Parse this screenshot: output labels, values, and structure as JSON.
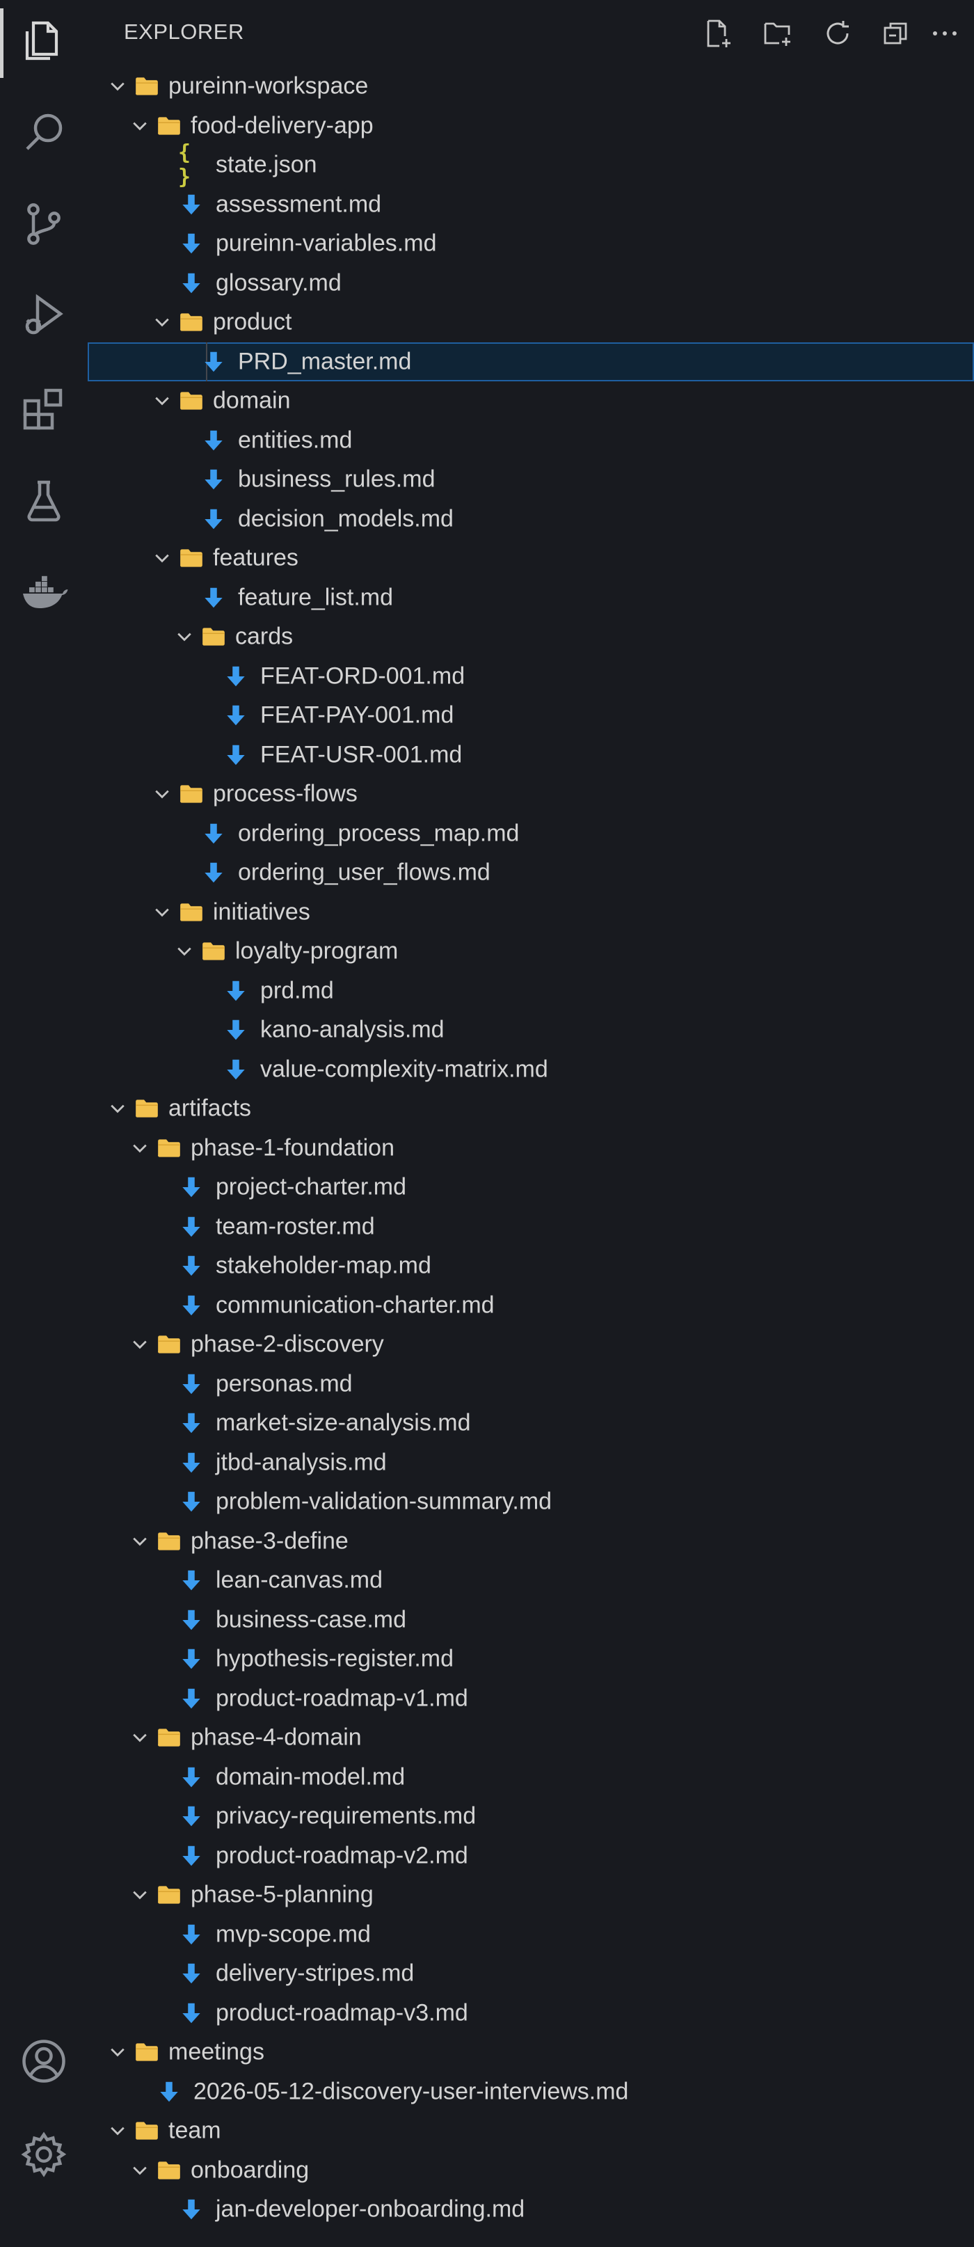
{
  "activity_bar": {
    "items": [
      {
        "name": "explorer-icon",
        "active": true
      },
      {
        "name": "search-icon"
      },
      {
        "name": "source-control-icon"
      },
      {
        "name": "run-debug-icon"
      },
      {
        "name": "extensions-icon"
      },
      {
        "name": "testing-icon"
      },
      {
        "name": "docker-icon"
      }
    ],
    "bottom": [
      {
        "name": "account-icon"
      },
      {
        "name": "settings-gear-icon"
      }
    ]
  },
  "explorer": {
    "title": "EXPLORER",
    "actions": [
      "new-file-icon",
      "new-folder-icon",
      "refresh-icon",
      "collapse-all-icon",
      "more-actions-icon"
    ]
  },
  "tree": [
    {
      "type": "folder",
      "depth": 0,
      "label": "pureinn-workspace"
    },
    {
      "type": "folder",
      "depth": 1,
      "label": "food-delivery-app"
    },
    {
      "type": "json",
      "depth": 2,
      "label": "state.json"
    },
    {
      "type": "md",
      "depth": 2,
      "label": "assessment.md"
    },
    {
      "type": "md",
      "depth": 2,
      "label": "pureinn-variables.md"
    },
    {
      "type": "md",
      "depth": 2,
      "label": "glossary.md"
    },
    {
      "type": "folder",
      "depth": 2,
      "label": "product"
    },
    {
      "type": "md",
      "depth": 3,
      "label": "PRD_master.md",
      "selected": true
    },
    {
      "type": "folder",
      "depth": 2,
      "label": "domain"
    },
    {
      "type": "md",
      "depth": 3,
      "label": "entities.md"
    },
    {
      "type": "md",
      "depth": 3,
      "label": "business_rules.md"
    },
    {
      "type": "md",
      "depth": 3,
      "label": "decision_models.md"
    },
    {
      "type": "folder",
      "depth": 2,
      "label": "features"
    },
    {
      "type": "md",
      "depth": 3,
      "label": "feature_list.md"
    },
    {
      "type": "folder",
      "depth": 3,
      "label": "cards"
    },
    {
      "type": "md",
      "depth": 4,
      "label": "FEAT-ORD-001.md"
    },
    {
      "type": "md",
      "depth": 4,
      "label": "FEAT-PAY-001.md"
    },
    {
      "type": "md",
      "depth": 4,
      "label": "FEAT-USR-001.md"
    },
    {
      "type": "folder",
      "depth": 2,
      "label": "process-flows"
    },
    {
      "type": "md",
      "depth": 3,
      "label": "ordering_process_map.md"
    },
    {
      "type": "md",
      "depth": 3,
      "label": "ordering_user_flows.md"
    },
    {
      "type": "folder",
      "depth": 2,
      "label": "initiatives"
    },
    {
      "type": "folder",
      "depth": 3,
      "label": "loyalty-program"
    },
    {
      "type": "md",
      "depth": 4,
      "label": "prd.md"
    },
    {
      "type": "md",
      "depth": 4,
      "label": "kano-analysis.md"
    },
    {
      "type": "md",
      "depth": 4,
      "label": "value-complexity-matrix.md"
    },
    {
      "type": "folder",
      "depth": 0,
      "label": "artifacts"
    },
    {
      "type": "folder",
      "depth": 1,
      "label": "phase-1-foundation"
    },
    {
      "type": "md",
      "depth": 2,
      "label": "project-charter.md"
    },
    {
      "type": "md",
      "depth": 2,
      "label": "team-roster.md"
    },
    {
      "type": "md",
      "depth": 2,
      "label": "stakeholder-map.md"
    },
    {
      "type": "md",
      "depth": 2,
      "label": "communication-charter.md"
    },
    {
      "type": "folder",
      "depth": 1,
      "label": "phase-2-discovery"
    },
    {
      "type": "md",
      "depth": 2,
      "label": "personas.md"
    },
    {
      "type": "md",
      "depth": 2,
      "label": "market-size-analysis.md"
    },
    {
      "type": "md",
      "depth": 2,
      "label": "jtbd-analysis.md"
    },
    {
      "type": "md",
      "depth": 2,
      "label": "problem-validation-summary.md"
    },
    {
      "type": "folder",
      "depth": 1,
      "label": "phase-3-define"
    },
    {
      "type": "md",
      "depth": 2,
      "label": "lean-canvas.md"
    },
    {
      "type": "md",
      "depth": 2,
      "label": "business-case.md"
    },
    {
      "type": "md",
      "depth": 2,
      "label": "hypothesis-register.md"
    },
    {
      "type": "md",
      "depth": 2,
      "label": "product-roadmap-v1.md"
    },
    {
      "type": "folder",
      "depth": 1,
      "label": "phase-4-domain"
    },
    {
      "type": "md",
      "depth": 2,
      "label": "domain-model.md"
    },
    {
      "type": "md",
      "depth": 2,
      "label": "privacy-requirements.md"
    },
    {
      "type": "md",
      "depth": 2,
      "label": "product-roadmap-v2.md"
    },
    {
      "type": "folder",
      "depth": 1,
      "label": "phase-5-planning"
    },
    {
      "type": "md",
      "depth": 2,
      "label": "mvp-scope.md"
    },
    {
      "type": "md",
      "depth": 2,
      "label": "delivery-stripes.md"
    },
    {
      "type": "md",
      "depth": 2,
      "label": "product-roadmap-v3.md"
    },
    {
      "type": "folder",
      "depth": 0,
      "label": "meetings"
    },
    {
      "type": "md",
      "depth": 1,
      "label": "2026-05-12-discovery-user-interviews.md"
    },
    {
      "type": "folder",
      "depth": 0,
      "label": "team"
    },
    {
      "type": "folder",
      "depth": 1,
      "label": "onboarding"
    },
    {
      "type": "md",
      "depth": 2,
      "label": "jan-developer-onboarding.md"
    }
  ],
  "colors": {
    "background": "#181a1f",
    "folder": "#f2c14e",
    "markdown_arrow": "#3b9cf0",
    "json": "#cbcb41",
    "text": "#d4d4d4",
    "selected_bg": "#0f2436",
    "selected_border": "#1f5fa0"
  }
}
